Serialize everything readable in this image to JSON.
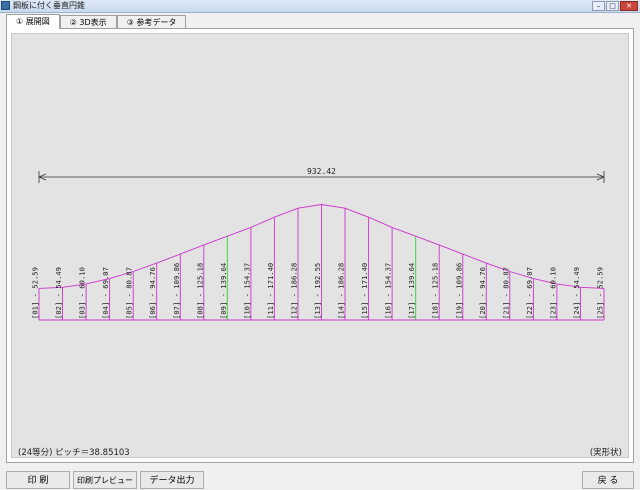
{
  "window": {
    "title": "鋼板に付く垂直円錐"
  },
  "tabs": [
    {
      "label": "① 展開図",
      "active": true
    },
    {
      "label": "② 3D表示",
      "active": false
    },
    {
      "label": "③ 参考データ",
      "active": false
    }
  ],
  "drawing": {
    "total_width_label": "932.42",
    "pitch_label": "(24等分) ピッチ＝38.85103",
    "shape_label": "(実形状)",
    "colors": {
      "outline": "#cc33cc",
      "dimension": "#333333",
      "highlight": "#33cc33"
    },
    "lines": [
      {
        "label": "[01] - 52.59",
        "value": 52.59
      },
      {
        "label": "[02] - 54.49",
        "value": 54.49
      },
      {
        "label": "[03] - 60.10",
        "value": 60.1
      },
      {
        "label": "[04] - 69.07",
        "value": 69.07
      },
      {
        "label": "[05] - 80.87",
        "value": 80.87
      },
      {
        "label": "[06] - 94.76",
        "value": 94.76
      },
      {
        "label": "[07] - 109.86",
        "value": 109.86
      },
      {
        "label": "[08] - 125.18",
        "value": 125.18
      },
      {
        "label": "[09] - 139.64",
        "value": 139.64,
        "highlight": true
      },
      {
        "label": "[10] - 154.37",
        "value": 154.37
      },
      {
        "label": "[11] - 171.40",
        "value": 171.4
      },
      {
        "label": "[12] - 186.28",
        "value": 186.28
      },
      {
        "label": "[13] - 192.55",
        "value": 192.55
      },
      {
        "label": "[14] - 186.28",
        "value": 186.28
      },
      {
        "label": "[15] - 171.40",
        "value": 171.4
      },
      {
        "label": "[16] - 154.37",
        "value": 154.37
      },
      {
        "label": "[17] - 139.64",
        "value": 139.64,
        "highlight": true
      },
      {
        "label": "[18] - 125.18",
        "value": 125.18
      },
      {
        "label": "[19] - 109.86",
        "value": 109.86
      },
      {
        "label": "[20] - 94.76",
        "value": 94.76
      },
      {
        "label": "[21] - 80.87",
        "value": 80.87
      },
      {
        "label": "[22] - 69.07",
        "value": 69.07
      },
      {
        "label": "[23] - 60.10",
        "value": 60.1
      },
      {
        "label": "[24] - 54.49",
        "value": 54.49
      },
      {
        "label": "[25] - 52.59",
        "value": 52.59
      }
    ]
  },
  "buttons": {
    "print": "印 刷",
    "preview": "印刷プレビュー",
    "export": "データ出力",
    "back": "戻 る"
  }
}
